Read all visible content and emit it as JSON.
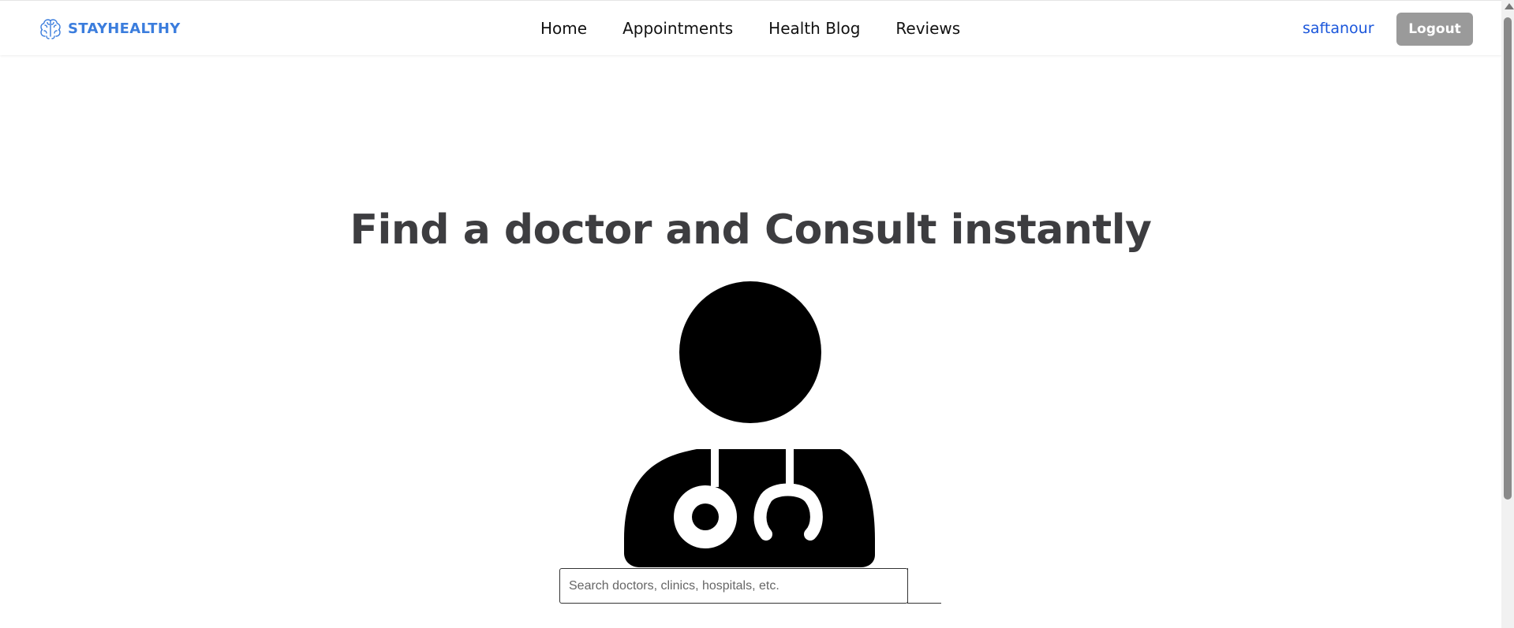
{
  "header": {
    "brand": "STAYHEALTHY",
    "brand_color": "#3b7ddd",
    "logo_icon": "brain-icon",
    "nav": [
      {
        "label": "Home"
      },
      {
        "label": "Appointments"
      },
      {
        "label": "Health Blog"
      },
      {
        "label": "Reviews"
      }
    ],
    "username": "saftanour",
    "logout_label": "Logout"
  },
  "hero": {
    "title": "Find a doctor and Consult instantly",
    "illustration": "doctor-icon"
  },
  "search": {
    "placeholder": "Search doctors, clinics, hospitals, etc.",
    "value": ""
  }
}
